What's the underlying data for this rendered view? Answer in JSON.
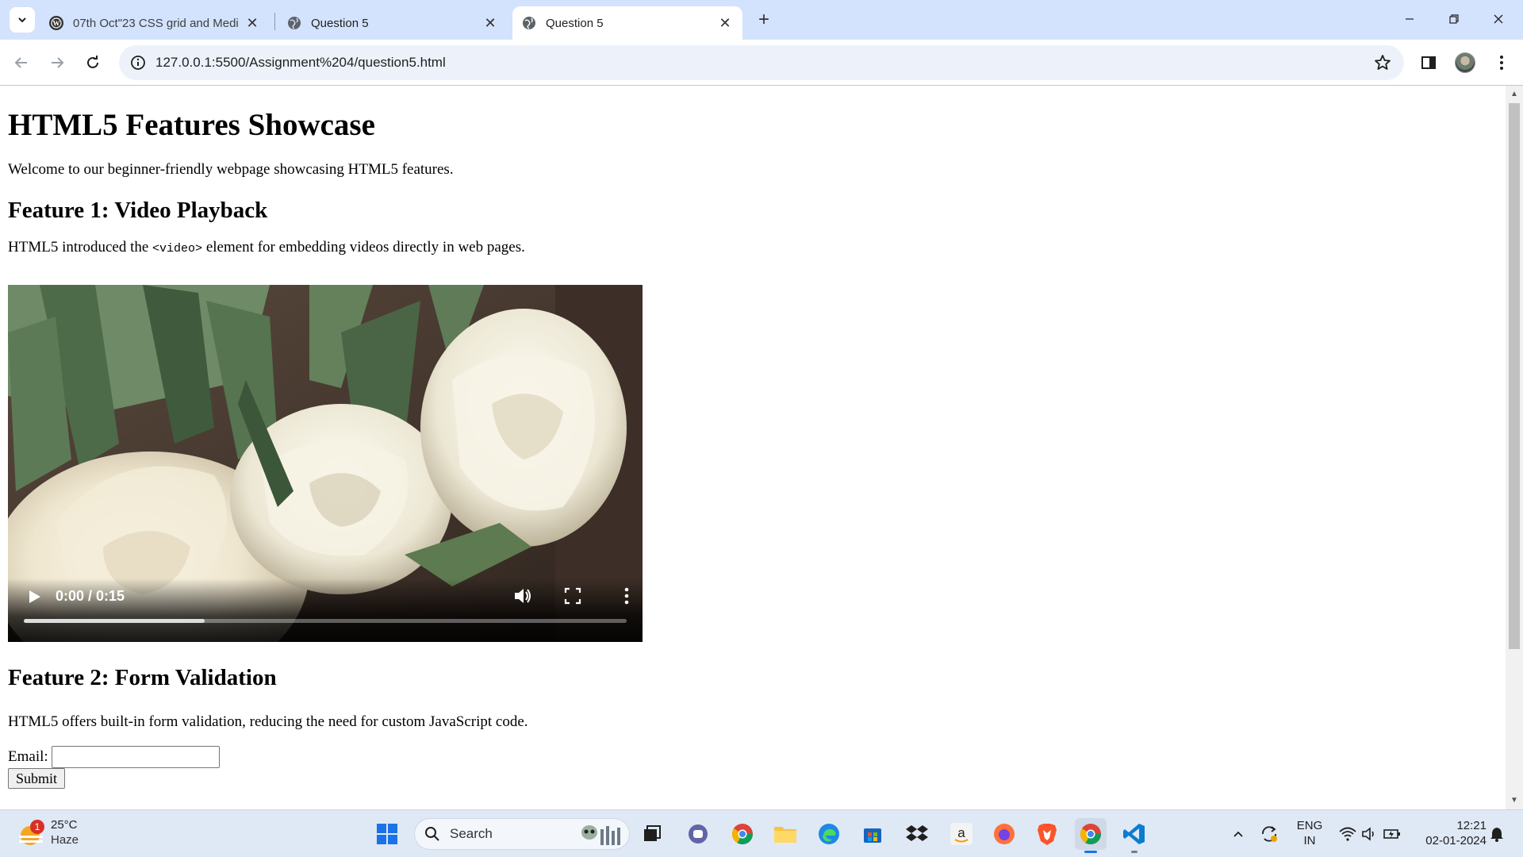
{
  "browser": {
    "tabs": [
      {
        "title": "07th Oct\"23 CSS grid and Medi",
        "active": false
      },
      {
        "title": "Question 5",
        "active": false
      },
      {
        "title": "Question 5",
        "active": true
      }
    ],
    "url": "127.0.0.1:5500/Assignment%204/question5.html"
  },
  "page": {
    "title": "HTML5 Features Showcase",
    "intro": "Welcome to our beginner-friendly webpage showcasing HTML5 features.",
    "feature1": {
      "heading": "Feature 1: Video Playback",
      "text_before": "HTML5 introduced the ",
      "code": "<video>",
      "text_after": " element for embedding videos directly in web pages.",
      "video": {
        "time": "0:00 / 0:15",
        "buffered_fraction": 0.3
      }
    },
    "feature2": {
      "heading": "Feature 2: Form Validation",
      "text": "HTML5 offers built-in form validation, reducing the need for custom JavaScript code.",
      "email_label": "Email:",
      "email_value": "",
      "submit_label": "Submit"
    }
  },
  "taskbar": {
    "weather": {
      "badge": "1",
      "temp": "25°C",
      "condition": "Haze"
    },
    "search_label": "Search",
    "lang": [
      "ENG",
      "IN"
    ],
    "time": "12:21",
    "date": "02-01-2024"
  },
  "colors": {
    "tabstrip": "#d3e3fd",
    "omnibox": "#edf2fa",
    "taskbar": "#dfe8f5"
  }
}
